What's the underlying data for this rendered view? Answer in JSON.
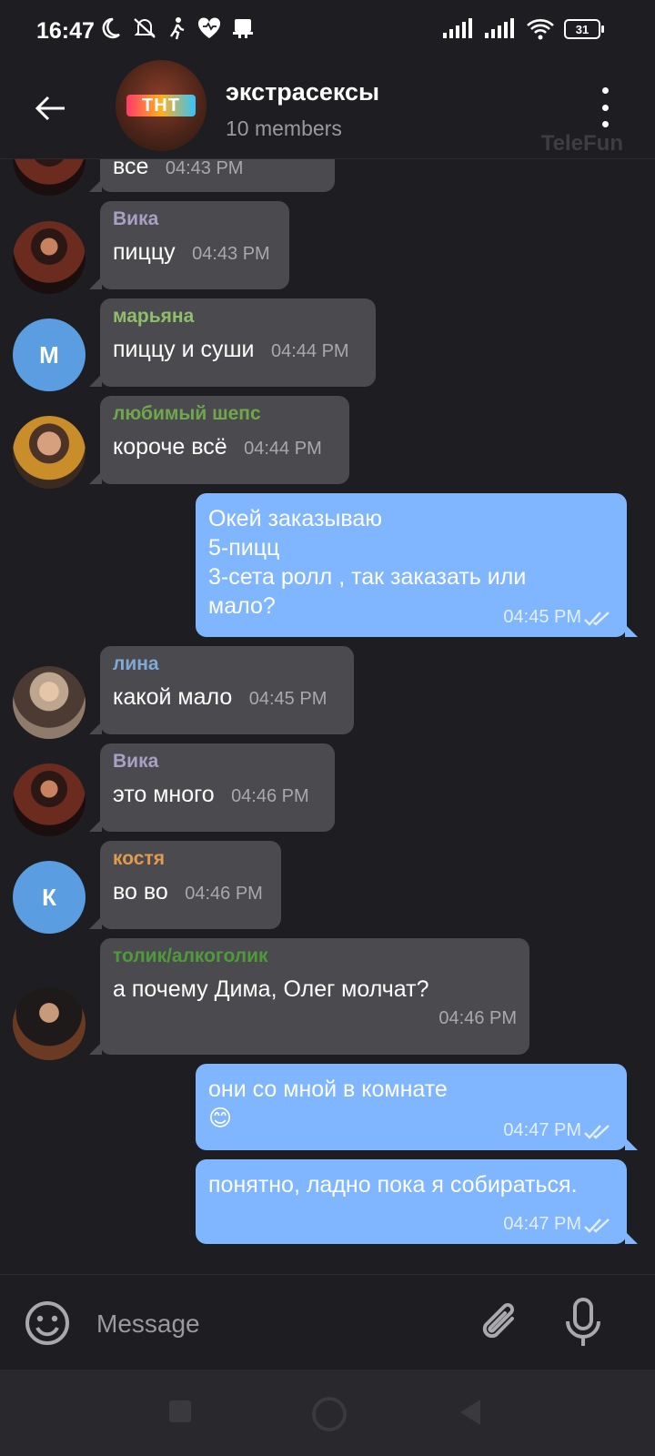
{
  "status_bar": {
    "time": "16:47",
    "battery": "31"
  },
  "header": {
    "title": "экстрасексы",
    "subtitle": "10 members",
    "watermark": "TeleFun",
    "avatar_logo": "ТНТ"
  },
  "messages": [
    {
      "id": "m0",
      "direction": "in",
      "sender": "",
      "text": "все",
      "time": "04:43 PM"
    },
    {
      "id": "m1",
      "direction": "in",
      "sender": "Вика",
      "sender_color": "#a9a0c4",
      "text": "пиццу",
      "time": "04:43 PM",
      "avatar": "photo"
    },
    {
      "id": "m2",
      "direction": "in",
      "sender": "марьяна",
      "sender_color": "#8fbf6a",
      "text": "пиццу и суши",
      "time": "04:44 PM",
      "avatar_letter": "М"
    },
    {
      "id": "m3",
      "direction": "in",
      "sender": "любимый шепс",
      "sender_color": "#6fa84a",
      "text": "короче всё",
      "time": "04:44 PM",
      "avatar": "photo"
    },
    {
      "id": "m4",
      "direction": "out",
      "text": "Окей заказываю\n5-пицц\n3-сета ролл , так заказать или\nмало?",
      "time": "04:45 PM",
      "status": "read"
    },
    {
      "id": "m5",
      "direction": "in",
      "sender": "лина",
      "sender_color": "#7eaad6",
      "text": "какой мало",
      "time": "04:45 PM",
      "avatar": "photo"
    },
    {
      "id": "m6",
      "direction": "in",
      "sender": "Вика",
      "sender_color": "#a9a0c4",
      "text": "это много",
      "time": "04:46 PM",
      "avatar": "photo"
    },
    {
      "id": "m7",
      "direction": "in",
      "sender": "костя",
      "sender_color": "#e29a4c",
      "text": "во во",
      "time": "04:46 PM",
      "avatar_letter": "К"
    },
    {
      "id": "m8",
      "direction": "in",
      "sender": "толик/алкоголик",
      "sender_color": "#4f9a3a",
      "text": "а почему Дима, Олег молчат?",
      "time": "04:46 PM",
      "avatar": "photo"
    },
    {
      "id": "m9",
      "direction": "out",
      "text": "они со мной в комнате\n😊",
      "time": "04:47 PM",
      "status": "read"
    },
    {
      "id": "m10",
      "direction": "out",
      "text": "понятно, ладно пока я собираться.",
      "time": "04:47 PM",
      "status": "read"
    }
  ],
  "input": {
    "placeholder": "Message"
  },
  "icons": {
    "back": "arrow-left",
    "menu": "more-vertical",
    "emoji": "smile-face",
    "attach": "paperclip",
    "mic": "microphone",
    "read_status": "double-check"
  },
  "colors": {
    "background": "#1e1d21",
    "incoming_bubble": "#4b4a4f",
    "outgoing_bubble": "#7fb6ff",
    "avatar_letter_bg": "#5a9de0"
  }
}
